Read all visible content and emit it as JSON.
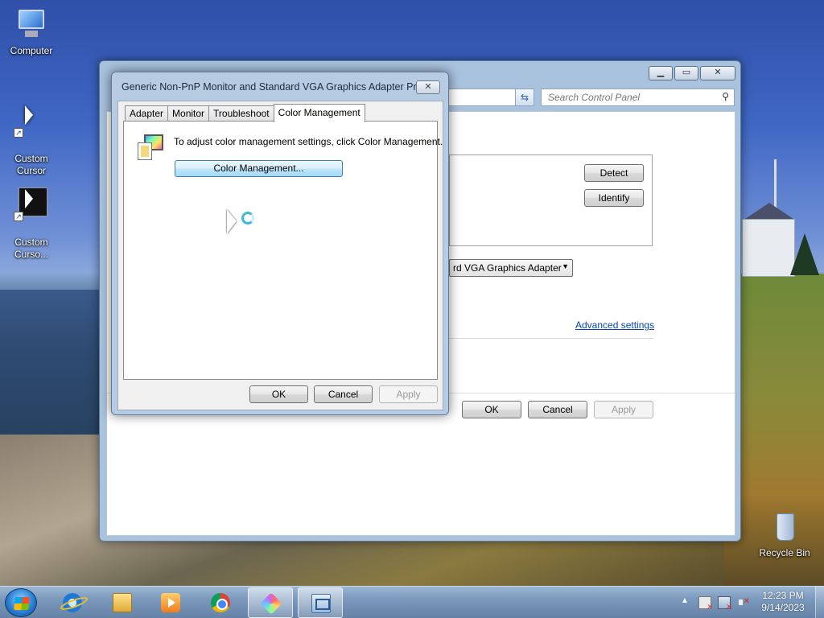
{
  "desktop": {
    "icons": [
      {
        "label": "Computer"
      },
      {
        "label": "Custom\nCursor"
      },
      {
        "label": "Custom\nCurso..."
      },
      {
        "label": "Recycle Bin"
      }
    ]
  },
  "control_panel": {
    "search_placeholder": "Search Control Panel",
    "detect_label": "Detect",
    "identify_label": "Identify",
    "display_combo_value": "rd VGA Graphics Adapter",
    "advanced_settings_link": "Advanced settings",
    "ok_label": "OK",
    "cancel_label": "Cancel",
    "apply_label": "Apply"
  },
  "dialog": {
    "title": "Generic Non-PnP Monitor and Standard VGA Graphics Adapter Pro...",
    "tabs": [
      {
        "label": "Adapter"
      },
      {
        "label": "Monitor"
      },
      {
        "label": "Troubleshoot"
      },
      {
        "label": "Color Management"
      }
    ],
    "active_tab": "Color Management",
    "description": "To adjust color management settings, click Color Management.",
    "color_management_button": "Color Management...",
    "ok_label": "OK",
    "cancel_label": "Cancel",
    "apply_label": "Apply"
  },
  "taskbar": {
    "clock_time": "12:23 PM",
    "clock_date": "9/14/2023",
    "pinned": [
      "internet-explorer",
      "windows-explorer",
      "media-player",
      "chrome",
      "paint",
      "control-panel"
    ]
  }
}
